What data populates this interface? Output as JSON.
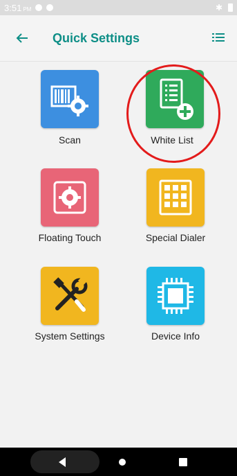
{
  "status_bar": {
    "time": "3:51",
    "ampm": "PM"
  },
  "app_bar": {
    "title": "Quick Settings",
    "back_icon": "arrow-left-icon",
    "menu_icon": "list-icon"
  },
  "tiles": [
    {
      "label": "Scan",
      "icon": "barcode-gear-icon",
      "color": "#3d8fe0"
    },
    {
      "label": "White List",
      "icon": "checklist-plus-icon",
      "color": "#2faa5b"
    },
    {
      "label": "Floating Touch",
      "icon": "gear-square-icon",
      "color": "#e86577"
    },
    {
      "label": "Special Dialer",
      "icon": "keypad-grid-icon",
      "color": "#f1b61f"
    },
    {
      "label": "System Settings",
      "icon": "tools-icon",
      "color": "#f1b61f"
    },
    {
      "label": "Device Info",
      "icon": "chip-icon",
      "color": "#1fb8e6"
    }
  ],
  "colors": {
    "accent": "#0d8e86",
    "highlight": "#e31b1b"
  },
  "nav": {
    "back_icon": "back-triangle-icon",
    "home_icon": "home-dot-icon",
    "recents_icon": "recents-square-icon"
  }
}
